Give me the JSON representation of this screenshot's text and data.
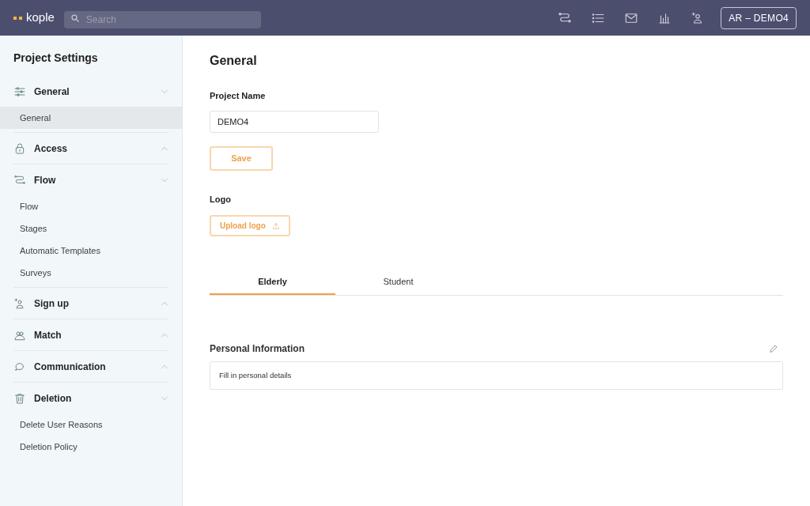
{
  "header": {
    "logo": "kople",
    "search": {
      "placeholder": "Search"
    },
    "account": "AR – DEMO4"
  },
  "sidebar": {
    "title": "Project Settings",
    "sections": [
      {
        "label": "General",
        "expanded": true,
        "children": [
          {
            "label": "General",
            "selected": true
          }
        ]
      },
      {
        "label": "Access",
        "expanded": false
      },
      {
        "label": "Flow",
        "expanded": true,
        "children": [
          {
            "label": "Flow",
            "selected": false
          },
          {
            "label": "Stages",
            "selected": false
          },
          {
            "label": "Automatic Templates",
            "selected": false
          },
          {
            "label": "Surveys",
            "selected": false
          }
        ]
      },
      {
        "label": "Sign up",
        "expanded": false
      },
      {
        "label": "Match",
        "expanded": false
      },
      {
        "label": "Communication",
        "expanded": false
      },
      {
        "label": "Deletion",
        "expanded": true,
        "children": [
          {
            "label": "Delete User Reasons",
            "selected": false
          },
          {
            "label": "Deletion Policy",
            "selected": false
          }
        ]
      }
    ]
  },
  "main": {
    "title": "General",
    "project_name": {
      "label": "Project Name",
      "value": "DEMO4"
    },
    "save_button": "Save",
    "logo": {
      "label": "Logo",
      "button": "Upload logo"
    },
    "tabs": [
      {
        "label": "Elderly",
        "selected": true
      },
      {
        "label": "Student",
        "selected": false
      }
    ],
    "personal_information": {
      "title": "Personal Information",
      "text": "Fill in personal details"
    }
  }
}
